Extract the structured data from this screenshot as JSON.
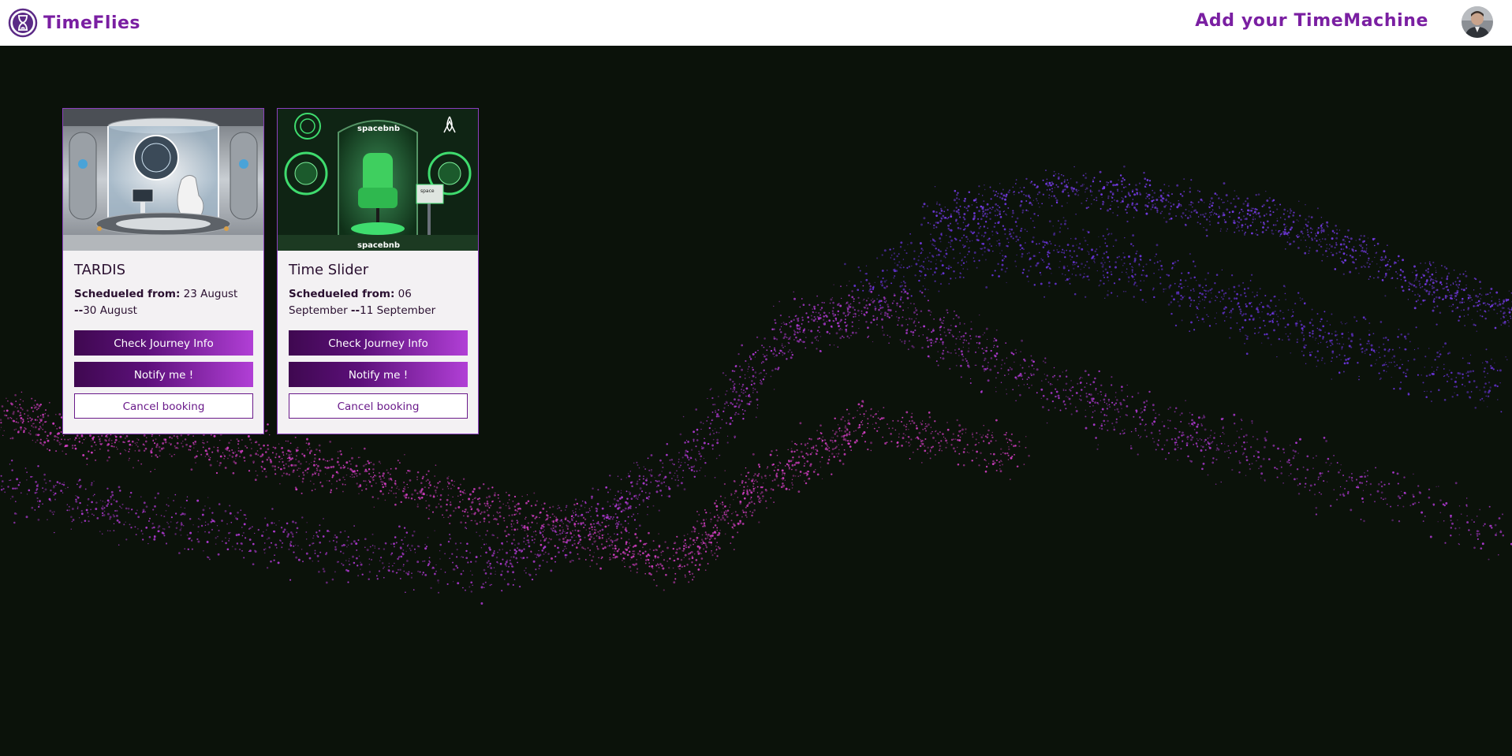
{
  "header": {
    "brand_name": "TimeFlies",
    "add_machine_label": "Add your TimeMachine",
    "logo_icon": "hourglass-icon",
    "avatar_icon": "user-avatar"
  },
  "colors": {
    "accent": "#7a1fa2",
    "background": "#0b120a",
    "card_bg": "#f3f1f3",
    "particles_pink": "#d83fd0",
    "particles_violet": "#8a3cf0"
  },
  "bookings": [
    {
      "title": "TARDIS",
      "scheduled_label": "Schedueled from:",
      "from": "23 August",
      "separator": "--",
      "to": "30 August",
      "check_label": "Check Journey Info",
      "notify_label": "Notify me !",
      "cancel_label": "Cancel booking"
    },
    {
      "title": "Time Slider",
      "scheduled_label": "Schedueled from:",
      "from": "06 September",
      "separator": "--",
      "to": "11 September",
      "check_label": "Check Journey Info",
      "notify_label": "Notify me !",
      "cancel_label": "Cancel booking",
      "image_text_top": "spacebnb",
      "image_text_bottom": "spacebnb",
      "image_text_console": "space"
    }
  ]
}
